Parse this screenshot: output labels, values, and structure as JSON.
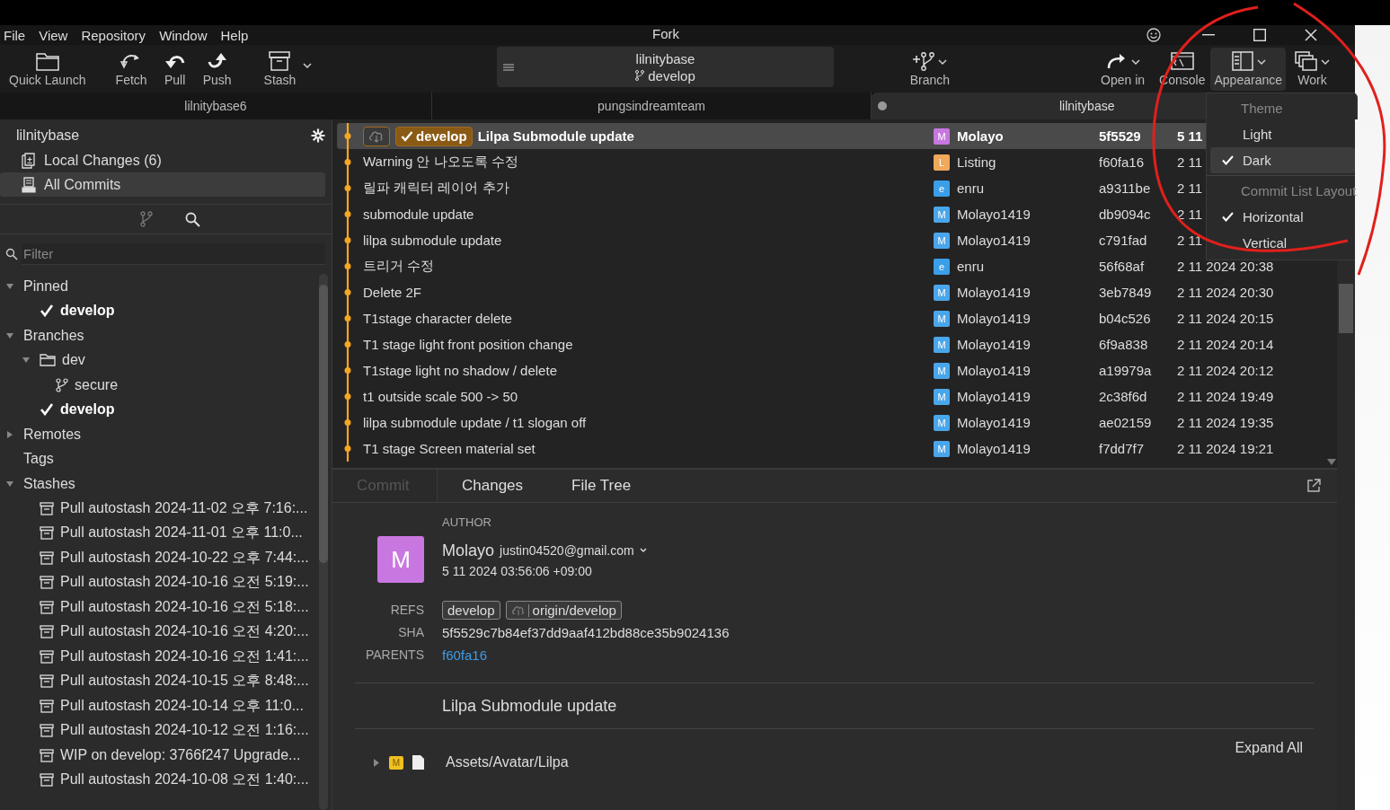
{
  "window": {
    "title": "Fork"
  },
  "menu_bar": [
    "File",
    "View",
    "Repository",
    "Window",
    "Help"
  ],
  "toolbar_left": [
    {
      "label": "Quick Launch",
      "kind": "folder",
      "dropdown": false
    },
    {
      "label": "Fetch",
      "kind": "fetch",
      "dropdown": false
    },
    {
      "label": "Pull",
      "kind": "pull",
      "dropdown": false
    },
    {
      "label": "Push",
      "kind": "push",
      "dropdown": false
    },
    {
      "label": "Stash",
      "kind": "stash",
      "dropdown": true
    }
  ],
  "branch_selector": {
    "repo": "lilnitybase",
    "branch": "develop"
  },
  "toolbar_right": [
    {
      "label": "Branch",
      "kind": "branch",
      "dropdown": true,
      "selected": false
    },
    {
      "label": "Open in",
      "kind": "open",
      "dropdown": true,
      "selected": false
    },
    {
      "label": "Console",
      "kind": "console",
      "dropdown": false,
      "selected": false
    },
    {
      "label": "Appearance",
      "kind": "appearance",
      "dropdown": true,
      "selected": true
    },
    {
      "label": "Work",
      "kind": "work",
      "dropdown": true,
      "selected": false
    }
  ],
  "repo_tabs": [
    {
      "label": "lilnitybase6",
      "selected": false
    },
    {
      "label": "pungsindreamteam",
      "selected": false
    },
    {
      "label": "lilnitybase",
      "selected": true
    }
  ],
  "sidebar": {
    "repo_name": "lilnitybase",
    "nav": [
      {
        "label": "Local Changes (6)",
        "kind": "changes",
        "selected": false
      },
      {
        "label": "All Commits",
        "kind": "commits",
        "selected": true
      }
    ],
    "filter": {
      "placeholder": "Filter"
    },
    "tree": [
      {
        "label": "Pinned",
        "expanded": true,
        "children": [
          {
            "label": "develop",
            "kind": "current"
          }
        ]
      },
      {
        "label": "Branches",
        "expanded": true,
        "children": [
          {
            "label": "dev",
            "kind": "folder",
            "expanded": true,
            "children": [
              {
                "label": "secure",
                "kind": "branch"
              }
            ]
          },
          {
            "label": "develop",
            "kind": "current"
          }
        ]
      },
      {
        "label": "Remotes",
        "expanded": false
      },
      {
        "label": "Tags"
      },
      {
        "label": "Stashes",
        "expanded": true,
        "children": [
          {
            "label": "Pull autostash 2024-11-02 오후 7:16:...",
            "kind": "stash"
          },
          {
            "label": "Pull autostash 2024-11-01 오후 11:0...",
            "kind": "stash"
          },
          {
            "label": "Pull autostash 2024-10-22 오후 7:44:...",
            "kind": "stash"
          },
          {
            "label": "Pull autostash 2024-10-16 오전 5:19:...",
            "kind": "stash"
          },
          {
            "label": "Pull autostash 2024-10-16 오전 5:18:...",
            "kind": "stash"
          },
          {
            "label": "Pull autostash 2024-10-16 오전 4:20:...",
            "kind": "stash"
          },
          {
            "label": "Pull autostash 2024-10-16 오전 1:41:...",
            "kind": "stash"
          },
          {
            "label": "Pull autostash 2024-10-15 오후 8:48:...",
            "kind": "stash"
          },
          {
            "label": "Pull autostash 2024-10-14 오후 11:0...",
            "kind": "stash"
          },
          {
            "label": "Pull autostash 2024-10-12 오전 1:16:...",
            "kind": "stash"
          },
          {
            "label": "WIP on develop: 3766f247 Upgrade...",
            "kind": "stash"
          },
          {
            "label": "Pull autostash 2024-10-08 오전 1:40:...",
            "kind": "stash"
          }
        ]
      }
    ]
  },
  "commits": [
    {
      "message": "Lilpa Submodule update",
      "refs": [
        {
          "kind": "remote"
        },
        {
          "kind": "current",
          "label": "develop"
        }
      ],
      "author": "Molayo",
      "avatar": "M",
      "color": "#c877e0",
      "sha": "5f5529",
      "date": "5 11",
      "selected": true
    },
    {
      "message": "Warning 안 나오도록 수정",
      "author": "Listing",
      "avatar": "L",
      "color": "#f0a85a",
      "sha": "f60fa16",
      "date": "2 11",
      "selected": false
    },
    {
      "message": "릴파 캐릭터 레이어 추가",
      "author": "enru",
      "avatar": "e",
      "color": "#3a9ee8",
      "sha": "a9311be",
      "date": "2 11",
      "selected": false
    },
    {
      "message": "submodule update",
      "author": "Molayo1419",
      "avatar": "M",
      "color": "#4aa6ea",
      "sha": "db9094c",
      "date": "2 11",
      "selected": false
    },
    {
      "message": "lilpa submodule update",
      "author": "Molayo1419",
      "avatar": "M",
      "color": "#4aa6ea",
      "sha": "c791fad",
      "date": "2 11",
      "selected": false
    },
    {
      "message": "트리거 수정",
      "author": "enru",
      "avatar": "e",
      "color": "#3a9ee8",
      "sha": "56f68af",
      "date": "2 11 2024 20:38",
      "selected": false
    },
    {
      "message": "Delete 2F",
      "author": "Molayo1419",
      "avatar": "M",
      "color": "#4aa6ea",
      "sha": "3eb7849",
      "date": "2 11 2024 20:30",
      "selected": false
    },
    {
      "message": "T1stage character delete",
      "author": "Molayo1419",
      "avatar": "M",
      "color": "#4aa6ea",
      "sha": "b04c526",
      "date": "2 11 2024 20:15",
      "selected": false
    },
    {
      "message": "T1 stage light front position change",
      "author": "Molayo1419",
      "avatar": "M",
      "color": "#4aa6ea",
      "sha": "6f9a838",
      "date": "2 11 2024 20:14",
      "selected": false
    },
    {
      "message": "T1stage light no shadow / delete",
      "author": "Molayo1419",
      "avatar": "M",
      "color": "#4aa6ea",
      "sha": "a19979a",
      "date": "2 11 2024 20:12",
      "selected": false
    },
    {
      "message": "t1 outside scale 500 -> 50",
      "author": "Molayo1419",
      "avatar": "M",
      "color": "#4aa6ea",
      "sha": "2c38f6d",
      "date": "2 11 2024 19:49",
      "selected": false
    },
    {
      "message": "lilpa submodule update / t1 slogan off",
      "author": "Molayo1419",
      "avatar": "M",
      "color": "#4aa6ea",
      "sha": "ae02159",
      "date": "2 11 2024 19:35",
      "selected": false
    },
    {
      "message": "T1 stage Screen material set",
      "author": "Molayo1419",
      "avatar": "M",
      "color": "#4aa6ea",
      "sha": "f7dd7f7",
      "date": "2 11 2024 19:21",
      "selected": false
    }
  ],
  "appearance_menu": [
    {
      "header": "Theme",
      "items": [
        {
          "label": "Light",
          "checked": false,
          "selected": false
        },
        {
          "label": "Dark",
          "checked": true,
          "selected": true
        }
      ]
    },
    {
      "header": "Commit List Layout",
      "items": [
        {
          "label": "Horizontal",
          "checked": true,
          "selected": false
        },
        {
          "label": "Vertical",
          "checked": false,
          "selected": false
        }
      ]
    }
  ],
  "details": {
    "tabs": [
      {
        "label": "Commit",
        "selected": true
      },
      {
        "label": "Changes",
        "selected": false
      },
      {
        "label": "File Tree",
        "selected": false
      }
    ],
    "author_label": "AUTHOR",
    "author": {
      "avatar": "M",
      "color": "#c877e0",
      "name": "Molayo",
      "email": "justin04520@gmail.com",
      "date": "5 11 2024 03:56:06 +09:00"
    },
    "fields": [
      {
        "label": "REFS",
        "kind": "refs",
        "refs": [
          {
            "label": "develop",
            "remote": false
          },
          {
            "label": "origin/develop",
            "remote": true
          }
        ]
      },
      {
        "label": "SHA",
        "kind": "text",
        "value": "5f5529c7b84ef37dd9aaf412bd88ce35b9024136"
      },
      {
        "label": "PARENTS",
        "kind": "link",
        "value": "f60fa16"
      }
    ],
    "subject": "Lilpa Submodule update",
    "expand_all": "Expand All",
    "files": [
      {
        "path": "Assets/Avatar/Lilpa",
        "status": "M",
        "expanded": false
      }
    ]
  }
}
